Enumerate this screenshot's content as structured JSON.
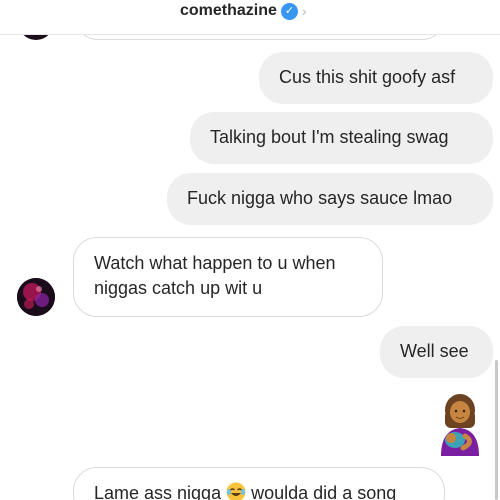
{
  "header": {
    "username": "comethazine",
    "verified_glyph": "✓",
    "chevron_glyph": "›"
  },
  "messages": [
    {
      "direction": "sent",
      "text": "Cus this shit goofy asf"
    },
    {
      "direction": "sent",
      "text": "Talking bout I'm stealing swag"
    },
    {
      "direction": "sent",
      "text": "Fuck nigga who says sauce lmao"
    },
    {
      "direction": "received",
      "line1": "Watch what happen to u when",
      "line2": "niggas catch up wit u"
    },
    {
      "direction": "sent",
      "text": "Well see"
    },
    {
      "direction": "sent",
      "emoji": "breastfeeding-woman-emoji"
    },
    {
      "direction": "received",
      "text_before": "Lame ass nigga",
      "emoji": "tears-of-joy-emoji",
      "text_after": "woulda did a song"
    }
  ],
  "colors": {
    "sent_bubble": "#efefef",
    "received_border": "#dbdbdb",
    "verified_badge": "#3897f0",
    "avatar_glow": "#c2185b"
  }
}
